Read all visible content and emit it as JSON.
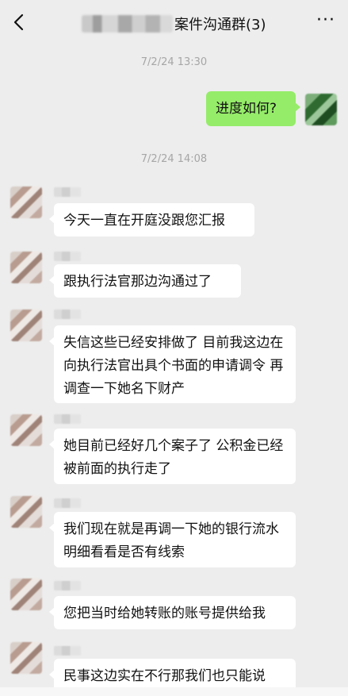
{
  "header": {
    "title_suffix": "案件沟通群(3)",
    "more_label": "···",
    "back_icon": "chevron-left-icon"
  },
  "messages": {
    "ts1": "7/2/24 13:30",
    "self_msg": "进度如何?",
    "ts2": "7/2/24 14:08",
    "m1": "今天一直在开庭没跟您汇报",
    "m2": "跟执行法官那边沟通过了",
    "m3": "失信这些已经安排做了 目前我这边在向执行法官出具个书面的申请调令 再调查一下她名下财产",
    "m4": "她目前已经好几个案子了 公积金已经被前面的执行走了",
    "m5": "我们现在就是再调一下她的银行流水明细看看是否有线索",
    "m6": "您把当时给她转账的账号提供给我",
    "m7": "民事这边实在不行那我们也只能说"
  },
  "colors": {
    "background": "#ededed",
    "self_bubble": "#95ec69",
    "other_bubble": "#ffffff"
  }
}
